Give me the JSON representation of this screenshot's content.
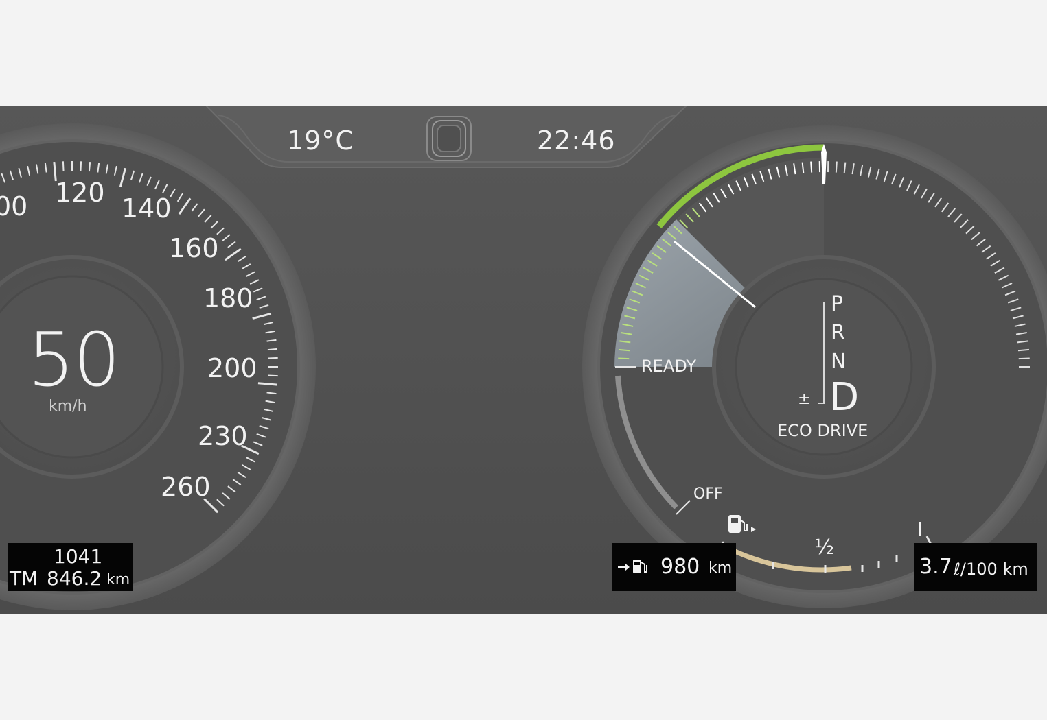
{
  "header": {
    "temperature": "19°C",
    "clock": "22:46",
    "center_icon": "volvo-emblem-icon"
  },
  "speedometer": {
    "speed": "50",
    "unit": "km/h",
    "scale_labels": [
      "00",
      "120",
      "140",
      "160",
      "180",
      "200",
      "230",
      "260"
    ]
  },
  "trip_box": {
    "odometer": "1041",
    "trip_prefix": "TM",
    "trip_value": "846.2",
    "trip_unit": "km"
  },
  "power_gauge": {
    "ready_label": "READY",
    "off_label": "OFF",
    "gear_options": [
      "P",
      "R",
      "N"
    ],
    "selected_gear": "D",
    "plus_minus": "±",
    "drive_mode": "ECO DRIVE",
    "colors": {
      "charge": "#8dc63f",
      "needle": "#ffffff"
    }
  },
  "fuel_gauge": {
    "half_label": "½",
    "full_label": "I",
    "icon": "fuel-pump-icon",
    "bar_color": "#d8c59a"
  },
  "range_box": {
    "icon": "fuel-range-icon",
    "value": "980",
    "unit": "km"
  },
  "consumption_box": {
    "value": "3.7",
    "unit": "ℓ/100 km"
  }
}
